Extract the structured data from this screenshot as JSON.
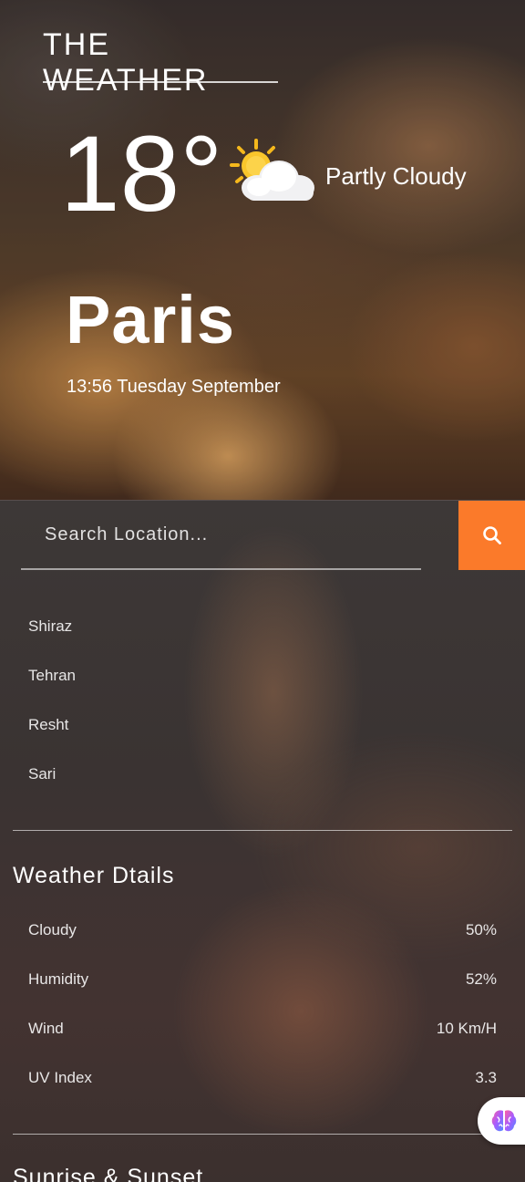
{
  "header": {
    "brand": "THE WEATHER"
  },
  "current": {
    "temperature": "18°",
    "condition": "Partly Cloudy",
    "condition_icon": "partly-cloudy-icon",
    "city": "Paris",
    "datetime": "13:56 Tuesday September"
  },
  "search": {
    "placeholder": "Search Location...",
    "button_icon": "search-icon",
    "accent_color": "#fb7a2a"
  },
  "locations": [
    "Shiraz",
    "Tehran",
    "Resht",
    "Sari"
  ],
  "details": {
    "title": "Weather Dtails",
    "rows": [
      {
        "label": "Cloudy",
        "value": "50%"
      },
      {
        "label": "Humidity",
        "value": "52%"
      },
      {
        "label": "Wind",
        "value": "10 Km/H"
      },
      {
        "label": "UV Index",
        "value": "3.3"
      }
    ]
  },
  "sunrise": {
    "title": "Sunrise & Sunset"
  },
  "widget": {
    "icon": "brain-icon"
  }
}
